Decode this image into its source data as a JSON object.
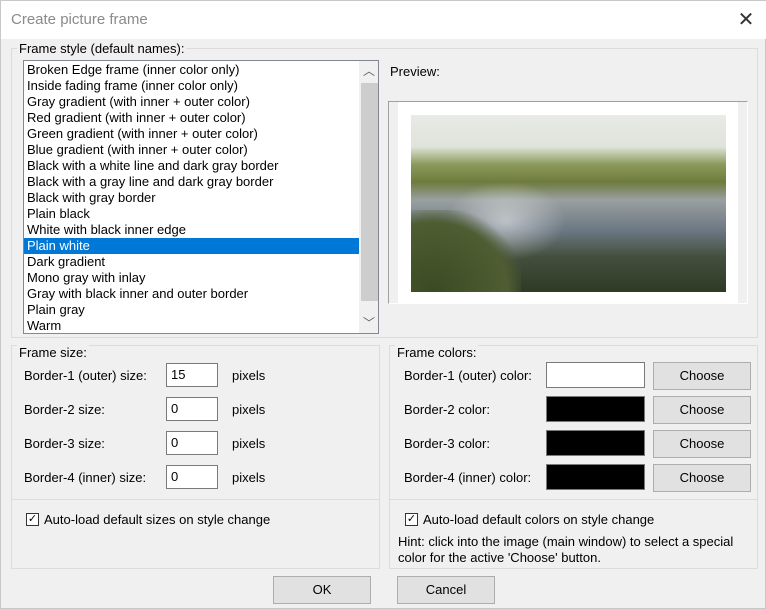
{
  "window": {
    "title": "Create picture frame",
    "close_icon": "close-icon"
  },
  "frame_style": {
    "label": "Frame style (default names):",
    "items": [
      "Broken Edge frame (inner color only)",
      "Inside fading frame (inner color only)",
      "Gray gradient (with inner + outer color)",
      "Red gradient (with inner + outer color)",
      "Green gradient (with inner + outer color)",
      "Blue gradient (with inner + outer color)",
      "Black with a white line and dark gray border",
      "Black with a gray line and dark gray border",
      "Black with gray border",
      "Plain black",
      "White with black inner edge",
      "Plain white",
      "Dark gradient",
      "Mono gray with inlay",
      "Gray with black inner and outer border",
      "Plain gray",
      "Warm"
    ],
    "selected_index": 11
  },
  "preview": {
    "label": "Preview:"
  },
  "frame_size": {
    "label": "Frame size:",
    "rows": [
      {
        "label": "Border-1 (outer) size:",
        "value": "15",
        "unit": "pixels"
      },
      {
        "label": "Border-2 size:",
        "value": "0",
        "unit": "pixels"
      },
      {
        "label": "Border-3 size:",
        "value": "0",
        "unit": "pixels"
      },
      {
        "label": "Border-4 (inner) size:",
        "value": "0",
        "unit": "pixels"
      }
    ],
    "autoload_label": "Auto-load default sizes on style change",
    "autoload_checked": true
  },
  "frame_colors": {
    "label": "Frame colors:",
    "rows": [
      {
        "label": "Border-1 (outer) color:",
        "color": "#ffffff",
        "button": "Choose"
      },
      {
        "label": "Border-2 color:",
        "color": "#000000",
        "button": "Choose"
      },
      {
        "label": "Border-3 color:",
        "color": "#000000",
        "button": "Choose"
      },
      {
        "label": "Border-4 (inner) color:",
        "color": "#000000",
        "button": "Choose"
      }
    ],
    "autoload_label": "Auto-load default colors on style change",
    "autoload_checked": true,
    "hint_line1": "Hint: click into the image (main window) to select a special",
    "hint_line2": "color for the active 'Choose' button."
  },
  "buttons": {
    "ok": "OK",
    "cancel": "Cancel"
  }
}
